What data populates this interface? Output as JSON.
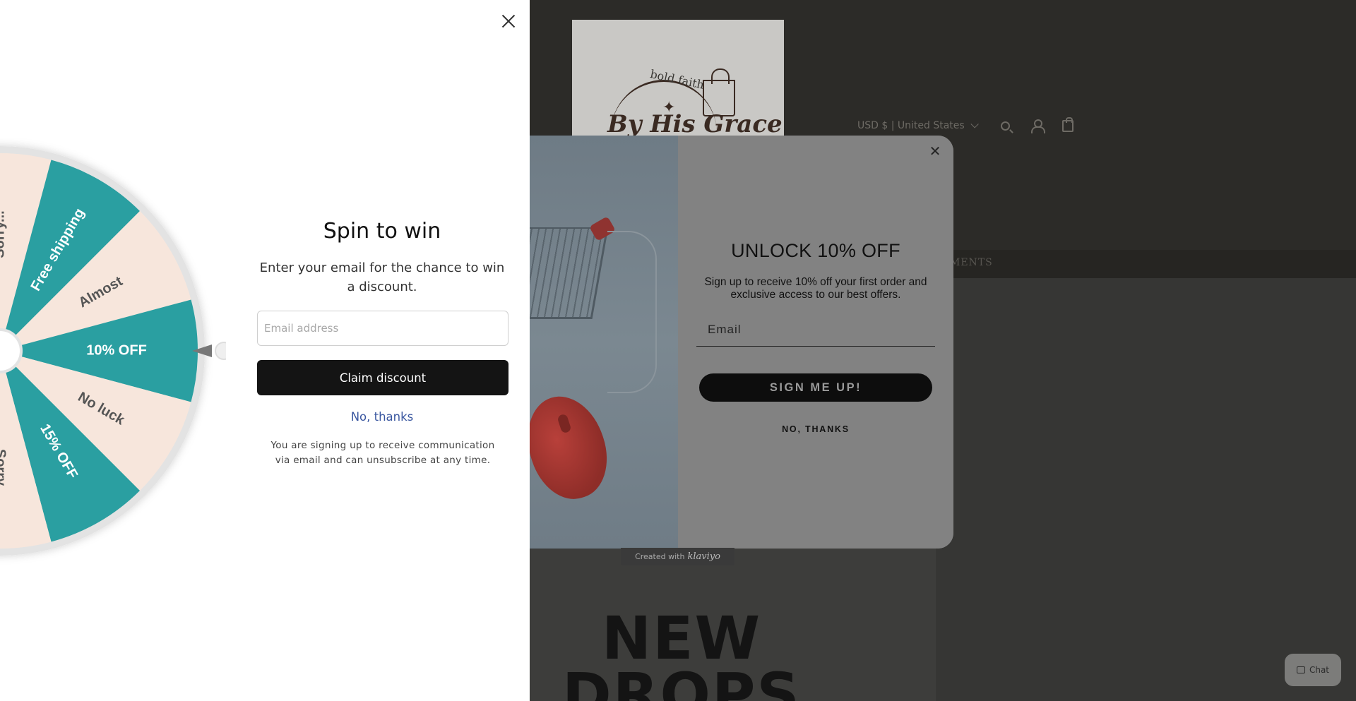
{
  "store": {
    "logo": {
      "tagline": "bold faith",
      "brand": "By His Grace"
    },
    "currency": "USD $ | United States",
    "nav_partial": "MENTS",
    "hero_text_line1": "NEW",
    "hero_text_line2": "DROPS",
    "chat_label": "Chat"
  },
  "klaviyo_popup": {
    "title": "UNLOCK 10% OFF",
    "subtitle": "Sign up to receive 10% off your first order and exclusive access to our best offers.",
    "email_placeholder": "Email",
    "signup_label": "SIGN ME UP!",
    "no_thanks_label": "NO, THANKS",
    "close_glyph": "✕",
    "badge_prefix": "Created with",
    "badge_brand": "klaviyo"
  },
  "spin_panel": {
    "title": "Spin to win",
    "subtitle": "Enter your email for the chance to win a discount.",
    "email_placeholder": "Email address",
    "claim_label": "Claim discount",
    "no_thanks_label": "No, thanks",
    "fine_print": "You are signing up to receive communication via email and can unsubscribe at any time.",
    "wheel": {
      "colors": {
        "teal": "#2a9fa1",
        "cream": "#f7e6dc",
        "rim": "#e3e3e3",
        "text_light": "#ffffff",
        "text_dark": "#555555"
      },
      "segments": [
        {
          "label": "Sorry...",
          "color": "cream"
        },
        {
          "label": "Free shipping",
          "color": "teal"
        },
        {
          "label": "Almost",
          "color": "cream"
        },
        {
          "label": "10% OFF",
          "color": "teal"
        },
        {
          "label": "No luck",
          "color": "cream"
        },
        {
          "label": "15% OFF",
          "color": "teal"
        },
        {
          "label": "Sorry",
          "color": "cream"
        }
      ]
    }
  }
}
